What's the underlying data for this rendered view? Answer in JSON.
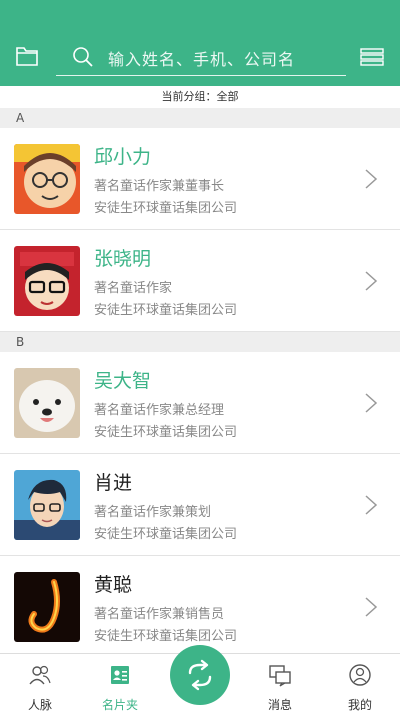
{
  "header": {
    "search_placeholder": "输入姓名、手机、公司名",
    "folder_icon": "folder-icon",
    "search_icon": "search-icon",
    "menu_icon": "menu-icon"
  },
  "group_label": "当前分组：全部",
  "sections": [
    {
      "letter": "A"
    },
    {
      "letter": "B"
    }
  ],
  "contacts": [
    {
      "name": "邱小力",
      "title": "著名童话作家兼董事长",
      "company": "安徒生环球童话集团公司"
    },
    {
      "name": "张晓明",
      "title": "著名童话作家",
      "company": "安徒生环球童话集团公司"
    },
    {
      "name": "吴大智",
      "title": "著名童话作家兼总经理",
      "company": "安徒生环球童话集团公司"
    },
    {
      "name": "肖进",
      "title": "著名童话作家兼策划",
      "company": "安徒生环球童话集团公司"
    },
    {
      "name": "黄聪",
      "title": "著名童话作家兼销售员",
      "company": "安徒生环球童话集团公司"
    }
  ],
  "tabs": [
    {
      "label": "人脉"
    },
    {
      "label": "名片夹"
    },
    {
      "label": "消息"
    },
    {
      "label": "我的"
    }
  ],
  "colors": {
    "accent": "#3db488"
  }
}
